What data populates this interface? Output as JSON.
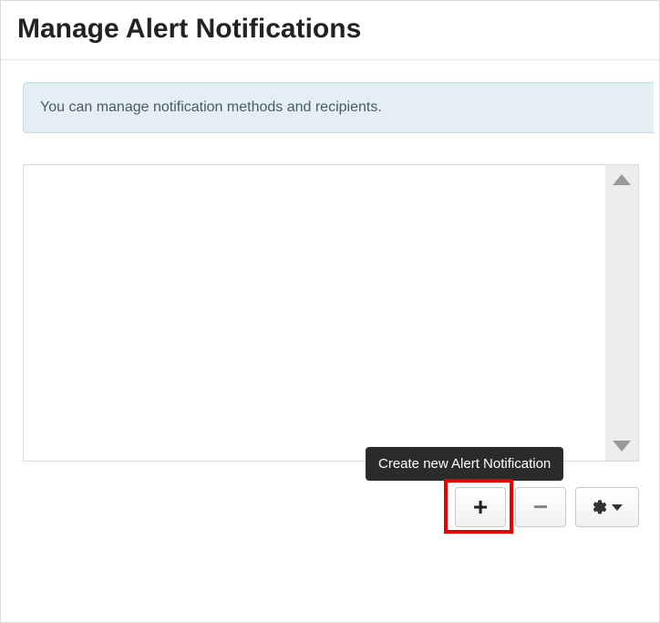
{
  "header": {
    "title": "Manage Alert Notifications"
  },
  "banner": {
    "text": "You can manage notification methods and recipients."
  },
  "toolbar": {
    "add_tooltip": "Create new Alert Notification",
    "add_glyph": "+",
    "remove_glyph": "−"
  }
}
